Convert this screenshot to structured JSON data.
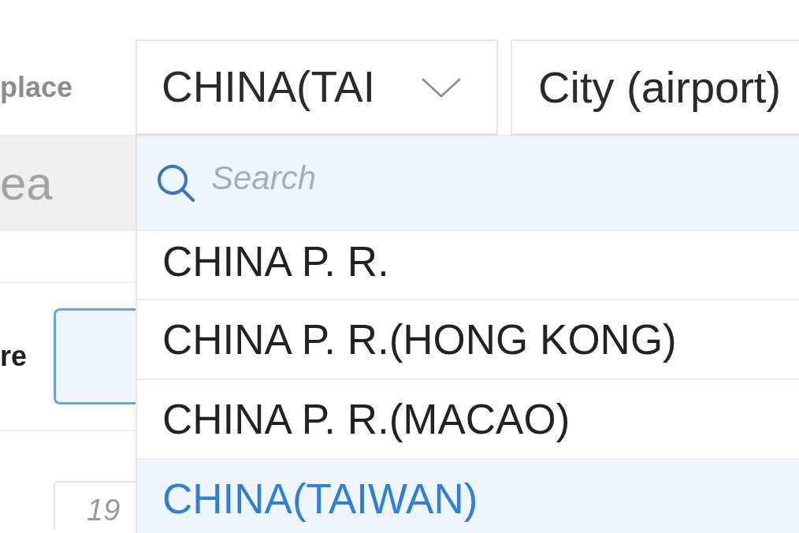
{
  "row_1": {
    "label": "place",
    "country_select": {
      "value": "CHINA(TAI",
      "expanded": true
    },
    "city_field": {
      "value": "City (airport)"
    }
  },
  "row_2": {
    "field": {
      "placeholder": "ea",
      "disabled": true
    }
  },
  "row_3": {
    "label": "re",
    "field": {
      "focused": true
    }
  },
  "row_4": {
    "field": {
      "placeholder": "19",
      "focused": false
    }
  },
  "dropdown": {
    "search": {
      "placeholder": "Search"
    },
    "options": [
      {
        "label": "CHINA P. R.",
        "selected": false
      },
      {
        "label": "CHINA P. R.(HONG KONG)",
        "selected": false
      },
      {
        "label": "CHINA P. R.(MACAO)",
        "selected": false
      },
      {
        "label": "CHINA(TAIWAN)",
        "selected": true
      }
    ]
  }
}
